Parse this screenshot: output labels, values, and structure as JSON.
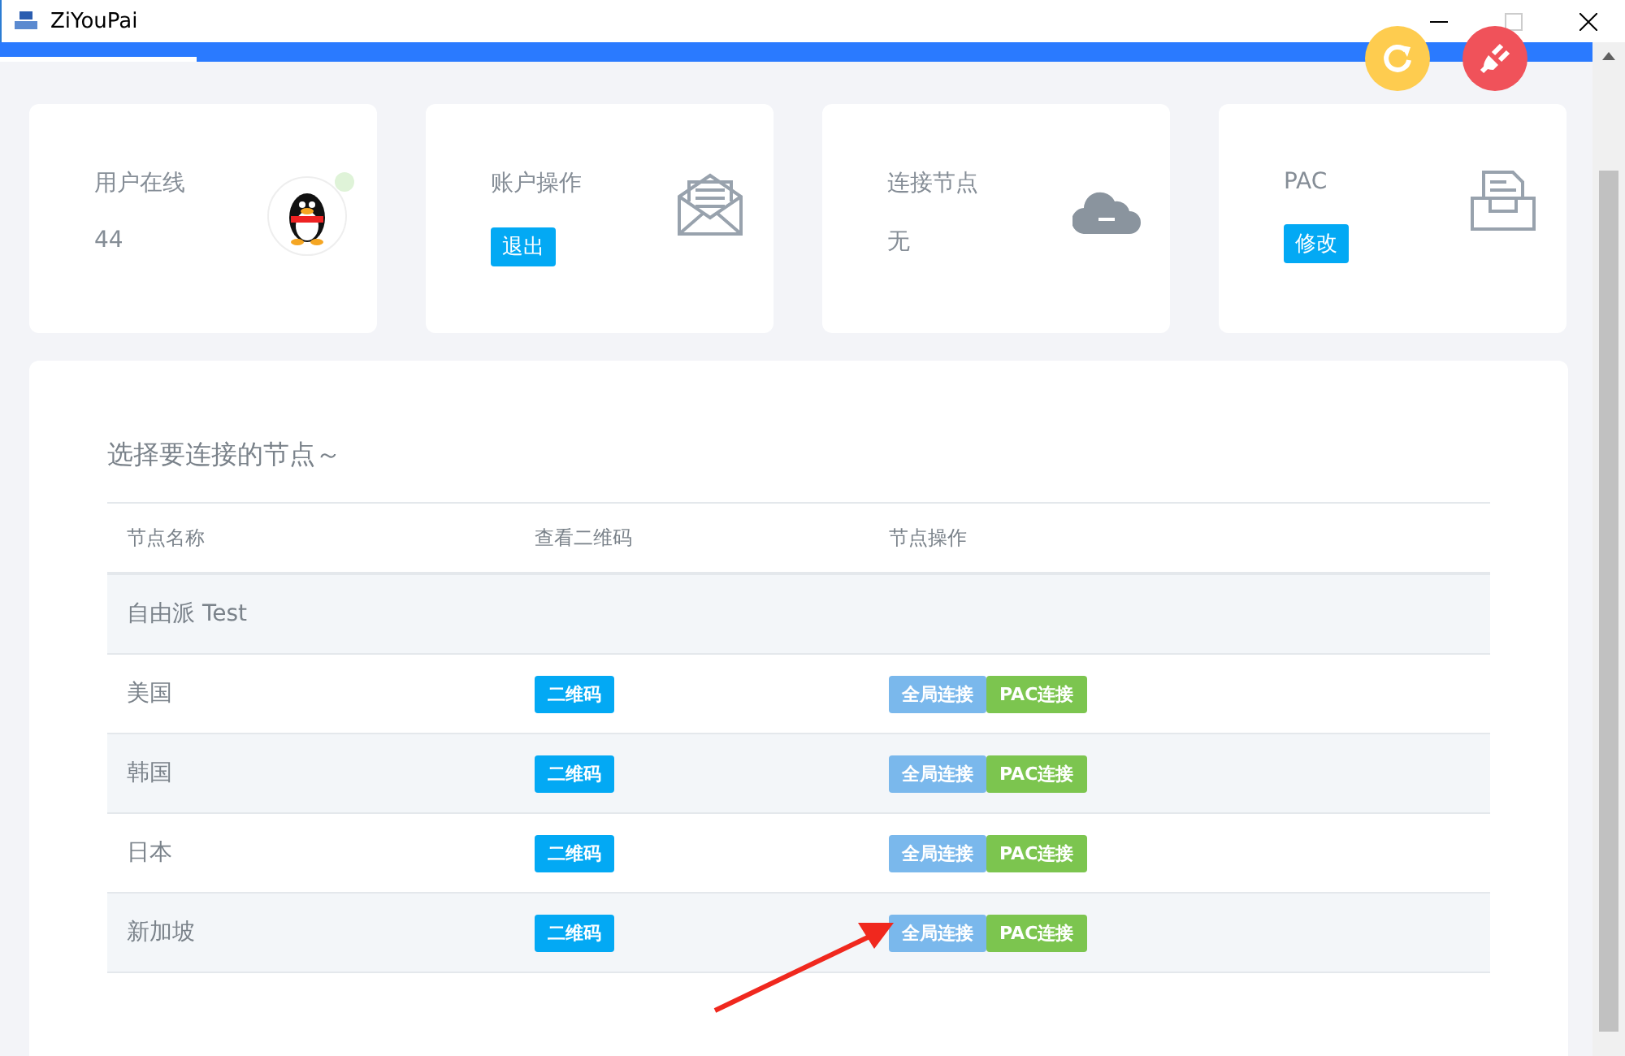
{
  "window": {
    "title": "ZiYouPai"
  },
  "cards": [
    {
      "label": "用户在线",
      "value": "44"
    },
    {
      "label": "账户操作",
      "button": "退出"
    },
    {
      "label": "连接节点",
      "value": "无"
    },
    {
      "label": "PAC",
      "button": "修改"
    }
  ],
  "panel": {
    "title": "选择要连接的节点～",
    "columns": [
      "节点名称",
      "查看二维码",
      "节点操作"
    ],
    "rows": [
      {
        "kind": "group",
        "name": "自由派 Test"
      },
      {
        "kind": "node",
        "name": "美国",
        "qr": "二维码",
        "actions": [
          "全局连接",
          "PAC连接"
        ]
      },
      {
        "kind": "node",
        "name": "韩国",
        "qr": "二维码",
        "actions": [
          "全局连接",
          "PAC连接"
        ]
      },
      {
        "kind": "node",
        "name": "日本",
        "qr": "二维码",
        "actions": [
          "全局连接",
          "PAC连接"
        ]
      },
      {
        "kind": "node",
        "name": "新加坡",
        "qr": "二维码",
        "actions": [
          "全局连接",
          "PAC连接"
        ]
      }
    ]
  }
}
